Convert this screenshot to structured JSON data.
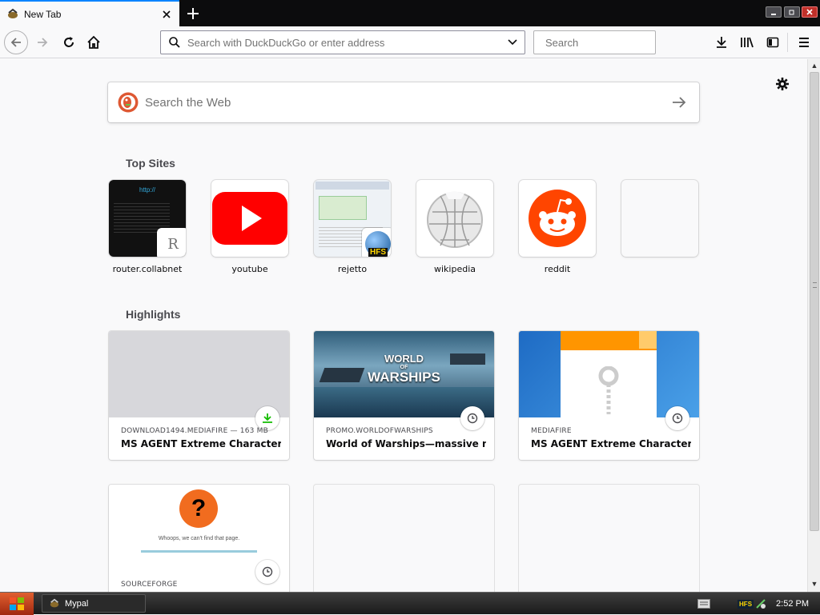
{
  "tab": {
    "title": "New Tab"
  },
  "urlbar": {
    "placeholder": "Search with DuckDuckGo or enter address"
  },
  "searchbar": {
    "placeholder": "Search"
  },
  "websearch": {
    "placeholder": "Search the Web"
  },
  "sections": {
    "top_sites": "Top Sites",
    "highlights": "Highlights"
  },
  "top_sites": [
    {
      "label": "router.collabnet",
      "letter": "R"
    },
    {
      "label": "youtube"
    },
    {
      "label": "rejetto",
      "badge": "HFS"
    },
    {
      "label": "wikipedia"
    },
    {
      "label": "reddit"
    },
    {
      "label": ""
    }
  ],
  "highlights": [
    {
      "source": "DOWNLOAD1494.MEDIAFIRE — 163 MB",
      "title": "MS AGENT Extreme Character P...",
      "badge_icon": "download-icon"
    },
    {
      "source": "PROMO.WORLDOFWARSHIPS",
      "title": "World of Warships—massive nav...",
      "badge_icon": "clock-icon",
      "image_text": [
        "WORLD",
        "OF",
        "WARSHIPS"
      ]
    },
    {
      "source": "MEDIAFIRE",
      "title": "MS AGENT Extreme Character P...",
      "badge_icon": "clock-icon"
    },
    {
      "source": "SOURCEFORGE",
      "title": "",
      "badge_icon": "clock-icon",
      "image_text": [
        "?",
        "Whoops, we can't find that page."
      ]
    },
    {
      "source": "",
      "title": ""
    },
    {
      "source": "",
      "title": ""
    }
  ],
  "taskbar": {
    "app": "Mypal",
    "clock": "2:52 PM",
    "tray_badge": "HFS"
  },
  "colors": {
    "accent": "#0a84ff",
    "youtube": "#ff0000",
    "reddit": "#ff4500",
    "ddg": "#de5833"
  }
}
